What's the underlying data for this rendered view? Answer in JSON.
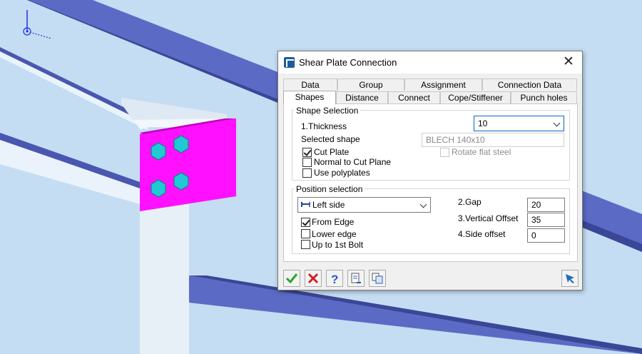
{
  "dialog": {
    "title": "Shear Plate Connection",
    "close_glyph": "✕",
    "icon": "app-icon"
  },
  "tabs_row1": [
    "Data",
    "Group",
    "Assignment",
    "Connection Data"
  ],
  "tabs_row2": [
    "Shapes",
    "Distance",
    "Connect",
    "Cope/Stiffener",
    "Punch holes"
  ],
  "active_tab": "Shapes",
  "shape_selection": {
    "title": "Shape Selection",
    "thickness_label": "1.Thickness",
    "thickness_value": "10",
    "selected_shape_label": "Selected shape",
    "selected_shape_value": "BLECH 140x10",
    "cut_plate_label": "Cut Plate",
    "cut_plate_checked": true,
    "normal_to_cut_plane_label": "Normal to Cut Plane",
    "normal_to_cut_plane_checked": false,
    "use_polyplates_label": "Use polyplates",
    "use_polyplates_checked": false,
    "rotate_flat_steel_label": "Rotate flat steel",
    "rotate_flat_steel_checked": false
  },
  "position_selection": {
    "title": "Position selection",
    "side_value": "Left side",
    "from_edge_label": "From Edge",
    "from_edge_checked": true,
    "lower_edge_label": "Lower edge",
    "lower_edge_checked": false,
    "up_to_1st_bolt_label": "Up to 1st Bolt",
    "up_to_1st_bolt_checked": false,
    "gap_label": "2.Gap",
    "gap_value": "20",
    "vertical_offset_label": "3.Vertical Offset",
    "vertical_offset_value": "35",
    "side_offset_label": "4.Side offset",
    "side_offset_value": "0"
  },
  "buttons": [
    "ok-check-icon",
    "cancel-x-icon",
    "help-icon",
    "export-icon",
    "copy-icon",
    "pin-icon"
  ],
  "colors": {
    "background": "#c5ddf2",
    "beam_blue": "#5b6ac5",
    "plate_magenta": "#ff10ff",
    "bolt_cyan": "#21c9d6"
  }
}
